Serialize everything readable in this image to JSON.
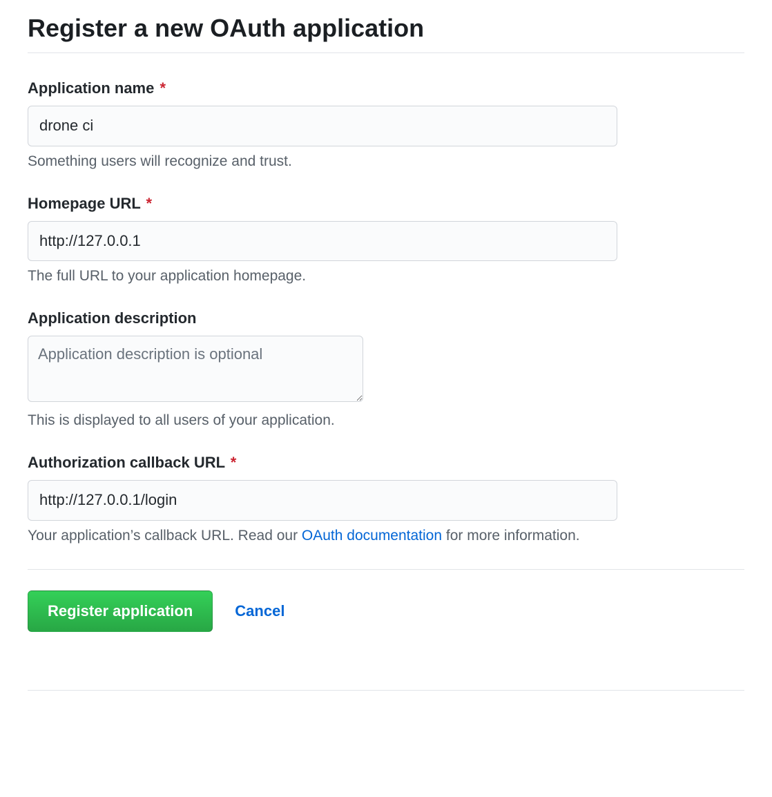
{
  "page": {
    "title": "Register a new OAuth application"
  },
  "form": {
    "app_name": {
      "label": "Application name",
      "required_mark": "*",
      "value": "drone ci",
      "hint": "Something users will recognize and trust."
    },
    "homepage_url": {
      "label": "Homepage URL",
      "required_mark": "*",
      "value": "http://127.0.0.1",
      "hint": "The full URL to your application homepage."
    },
    "description": {
      "label": "Application description",
      "placeholder": "Application description is optional",
      "value": "",
      "hint": "This is displayed to all users of your application."
    },
    "callback_url": {
      "label": "Authorization callback URL",
      "required_mark": "*",
      "value": "http://127.0.0.1/login",
      "hint_prefix": "Your application’s callback URL. Read our ",
      "hint_link": "OAuth documentation",
      "hint_suffix": " for more information."
    }
  },
  "actions": {
    "submit": "Register application",
    "cancel": "Cancel"
  }
}
